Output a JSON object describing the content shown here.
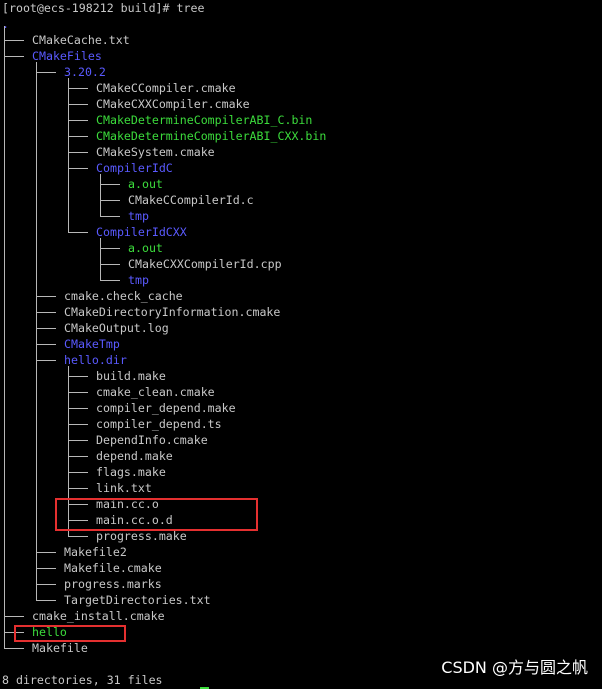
{
  "terminal": {
    "prompt": "[root@ecs-198212 build]# tree",
    "root": ".",
    "summary": "8 directories, 31 files",
    "watermark": "CSDN @方与圆之帆"
  },
  "tree": [
    {
      "name": "CMakeCache.txt",
      "depth": 1,
      "kind": "file"
    },
    {
      "name": "CMakeFiles",
      "depth": 1,
      "kind": "dir",
      "children": [
        {
          "name": "3.20.2",
          "depth": 2,
          "kind": "dir",
          "children": [
            {
              "name": "CMakeCCompiler.cmake",
              "depth": 3,
              "kind": "file"
            },
            {
              "name": "CMakeCXXCompiler.cmake",
              "depth": 3,
              "kind": "file"
            },
            {
              "name": "CMakeDetermineCompilerABI_C.bin",
              "depth": 3,
              "kind": "exe"
            },
            {
              "name": "CMakeDetermineCompilerABI_CXX.bin",
              "depth": 3,
              "kind": "exe"
            },
            {
              "name": "CMakeSystem.cmake",
              "depth": 3,
              "kind": "file"
            },
            {
              "name": "CompilerIdC",
              "depth": 3,
              "kind": "dir",
              "children": [
                {
                  "name": "a.out",
                  "depth": 4,
                  "kind": "exe"
                },
                {
                  "name": "CMakeCCompilerId.c",
                  "depth": 4,
                  "kind": "file"
                },
                {
                  "name": "tmp",
                  "depth": 4,
                  "kind": "dir"
                }
              ]
            },
            {
              "name": "CompilerIdCXX",
              "depth": 3,
              "kind": "dir",
              "children": [
                {
                  "name": "a.out",
                  "depth": 4,
                  "kind": "exe"
                },
                {
                  "name": "CMakeCXXCompilerId.cpp",
                  "depth": 4,
                  "kind": "file"
                },
                {
                  "name": "tmp",
                  "depth": 4,
                  "kind": "dir"
                }
              ]
            }
          ]
        },
        {
          "name": "cmake.check_cache",
          "depth": 2,
          "kind": "file"
        },
        {
          "name": "CMakeDirectoryInformation.cmake",
          "depth": 2,
          "kind": "file"
        },
        {
          "name": "CMakeOutput.log",
          "depth": 2,
          "kind": "file"
        },
        {
          "name": "CMakeTmp",
          "depth": 2,
          "kind": "dir"
        },
        {
          "name": "hello.dir",
          "depth": 2,
          "kind": "dir",
          "children": [
            {
              "name": "build.make",
              "depth": 3,
              "kind": "file"
            },
            {
              "name": "cmake_clean.cmake",
              "depth": 3,
              "kind": "file"
            },
            {
              "name": "compiler_depend.make",
              "depth": 3,
              "kind": "file"
            },
            {
              "name": "compiler_depend.ts",
              "depth": 3,
              "kind": "file"
            },
            {
              "name": "DependInfo.cmake",
              "depth": 3,
              "kind": "file"
            },
            {
              "name": "depend.make",
              "depth": 3,
              "kind": "file"
            },
            {
              "name": "flags.make",
              "depth": 3,
              "kind": "file"
            },
            {
              "name": "link.txt",
              "depth": 3,
              "kind": "file"
            },
            {
              "name": "main.cc.o",
              "depth": 3,
              "kind": "file"
            },
            {
              "name": "main.cc.o.d",
              "depth": 3,
              "kind": "file"
            },
            {
              "name": "progress.make",
              "depth": 3,
              "kind": "file"
            }
          ]
        },
        {
          "name": "Makefile2",
          "depth": 2,
          "kind": "file"
        },
        {
          "name": "Makefile.cmake",
          "depth": 2,
          "kind": "file"
        },
        {
          "name": "progress.marks",
          "depth": 2,
          "kind": "file"
        },
        {
          "name": "TargetDirectories.txt",
          "depth": 2,
          "kind": "file"
        }
      ]
    },
    {
      "name": "cmake_install.cmake",
      "depth": 1,
      "kind": "file"
    },
    {
      "name": "hello",
      "depth": 1,
      "kind": "exe"
    },
    {
      "name": "Makefile",
      "depth": 1,
      "kind": "file"
    }
  ],
  "colors": {
    "background": "#000000",
    "file": "#c8c8c8",
    "directory": "#5a5aff",
    "executable": "#3cdc3c",
    "highlight_box": "#e53030"
  }
}
